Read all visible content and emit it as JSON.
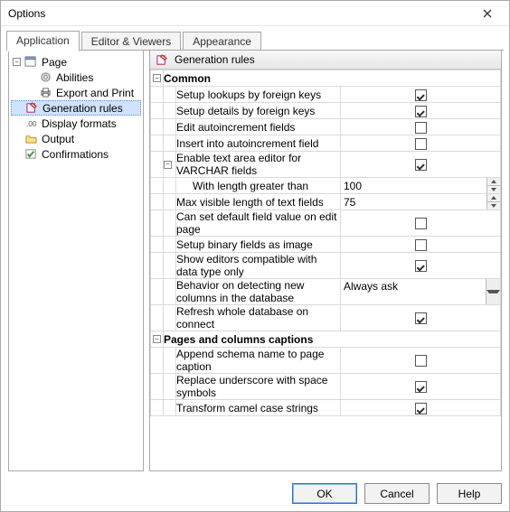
{
  "window": {
    "title": "Options"
  },
  "tabs": {
    "application": "Application",
    "editor": "Editor & Viewers",
    "appearance": "Appearance"
  },
  "tree": {
    "page": "Page",
    "abilities": "Abilities",
    "export": "Export and Print",
    "genrules": "Generation rules",
    "display": "Display formats",
    "output": "Output",
    "confirmations": "Confirmations"
  },
  "panel_title": "Generation rules",
  "sections": {
    "common": "Common",
    "pages": "Pages and columns captions"
  },
  "rows": {
    "lookups": "Setup lookups by foreign keys",
    "details": "Setup details by foreign keys",
    "editauto": "Edit autoincrement fields",
    "insertauto": "Insert into autoincrement field",
    "textarea": "Enable text area editor for VARCHAR fields",
    "withlen": "With length greater than",
    "maxvis": "Max visible length of text fields",
    "candefault": "Can set default field value on edit page",
    "binimg": "Setup binary fields as image",
    "showed": "Show editors compatible with data type only",
    "behavior": "Behavior on detecting new columns in the database",
    "refresh": "Refresh whole database on connect",
    "appendschema": "Append schema name to page caption",
    "underscore": "Replace underscore with space symbols",
    "camel": "Transform camel case strings"
  },
  "values": {
    "withlen": "100",
    "maxvis": "75",
    "behavior": "Always ask"
  },
  "buttons": {
    "ok": "OK",
    "cancel": "Cancel",
    "help": "Help"
  }
}
